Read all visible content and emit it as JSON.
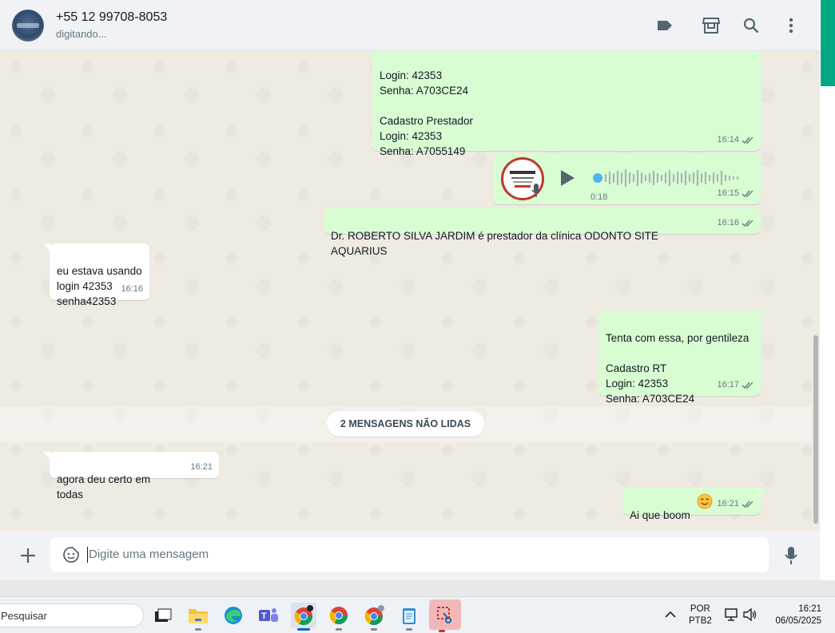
{
  "header": {
    "contact_name": "+55 12 99708-8053",
    "status": "digitando..."
  },
  "messages": [
    {
      "direction": "out",
      "text": "Login: 42353\nSenha:  A703CE24\n\nCadastro Prestador\nLogin: 42353\nSenha:  A7055149",
      "time": "16:14",
      "read": true
    },
    {
      "direction": "out",
      "type": "audio",
      "duration": "0:18",
      "time": "16:15",
      "read": true
    },
    {
      "direction": "out",
      "text": "Dr. ROBERTO SILVA JARDIM é prestador da clínica  ODONTO SITE AQUARIUS",
      "time": "16:16",
      "read": true
    },
    {
      "direction": "in",
      "text": "eu estava usando\nlogin 42353\nsenha42353",
      "time": "16:16"
    },
    {
      "direction": "out",
      "text": "Tenta com essa, por gentileza\n\nCadastro RT\nLogin: 42353\nSenha:  A703CE24",
      "time": "16:17",
      "read": true
    },
    {
      "direction": "in",
      "text": "agora deu certo em todas",
      "time": "16:21"
    },
    {
      "direction": "out",
      "text": "Ai que boom",
      "time": "16:21",
      "read": true
    }
  ],
  "unread_divider": "2 MENSAGENS NÃO LIDAS",
  "composer": {
    "placeholder": "Digite uma mensagem"
  },
  "taskbar": {
    "search_placeholder": "Pesquisar",
    "lang_line1": "POR",
    "lang_line2": "PTB2",
    "time": "16:21",
    "date": "06/05/2025"
  },
  "colors": {
    "outgoing_bubble": "#d9fdd3",
    "incoming_bubble": "#ffffff",
    "accent": "#00a884",
    "read_ticks": "#53bdeb"
  }
}
